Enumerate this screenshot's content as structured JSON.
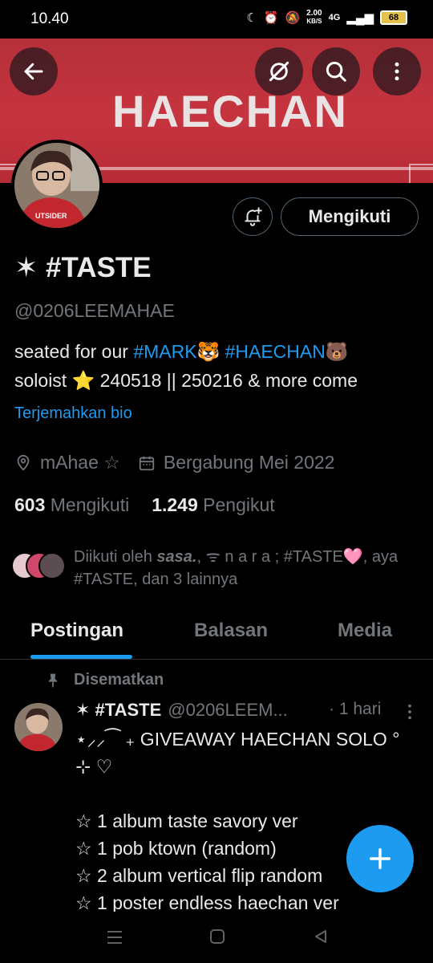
{
  "status_bar": {
    "time": "10.40",
    "network_speed": "2.00",
    "speed_unit": "KB/S",
    "signal": "4G",
    "battery": "68"
  },
  "banner": {
    "text": "HAECHAN",
    "color": "#c7343f"
  },
  "profile": {
    "display_name": "✶ #TASTE",
    "handle": "@0206LEEMAHAE",
    "bio_text_1": "seated for our ",
    "bio_tag_1": "#MARK🐯",
    "bio_text_2": " ",
    "bio_tag_2": "#HAECHAN🐻",
    "bio_line_2": "soloist ⭐ 240518 || 250216 & more come",
    "translate_label": "Terjemahkan bio",
    "location": "mAhae ☆",
    "joined": "Bergabung Mei 2022",
    "following_count": "603",
    "following_label": "Mengikuti",
    "followers_count": "1.249",
    "followers_label": "Pengikut",
    "followed_by_prefix": "Diikuti oleh ",
    "followed_by_name": "sasa.",
    "followed_by_rest": ", ᯤ n a r a ; #TASTE🩷, aya #TASTE, dan 3 lainnya"
  },
  "actions": {
    "follow_label": "Mengikuti"
  },
  "tabs": [
    {
      "label": "Postingan",
      "active": true
    },
    {
      "label": "Balasan",
      "active": false
    },
    {
      "label": "Media",
      "active": false
    }
  ],
  "pinned_post": {
    "pinned_label": "Disematkan",
    "author_name": "✶ #TASTE",
    "author_handle": "@0206LEEM...",
    "time": "· 1 hari",
    "body": "⋆⸝⸝⁀ ₊ GIVEAWAY HAECHAN SOLO ° ⊹ ♡\n\n☆ 1 album taste savory ver\n☆ 1 pob ktown (random)\n☆ 2 album vertical flip random\n☆ 1 poster endless haechan ver"
  },
  "colors": {
    "accent": "#1d9bf0",
    "background": "#000000",
    "muted": "#71767b"
  }
}
